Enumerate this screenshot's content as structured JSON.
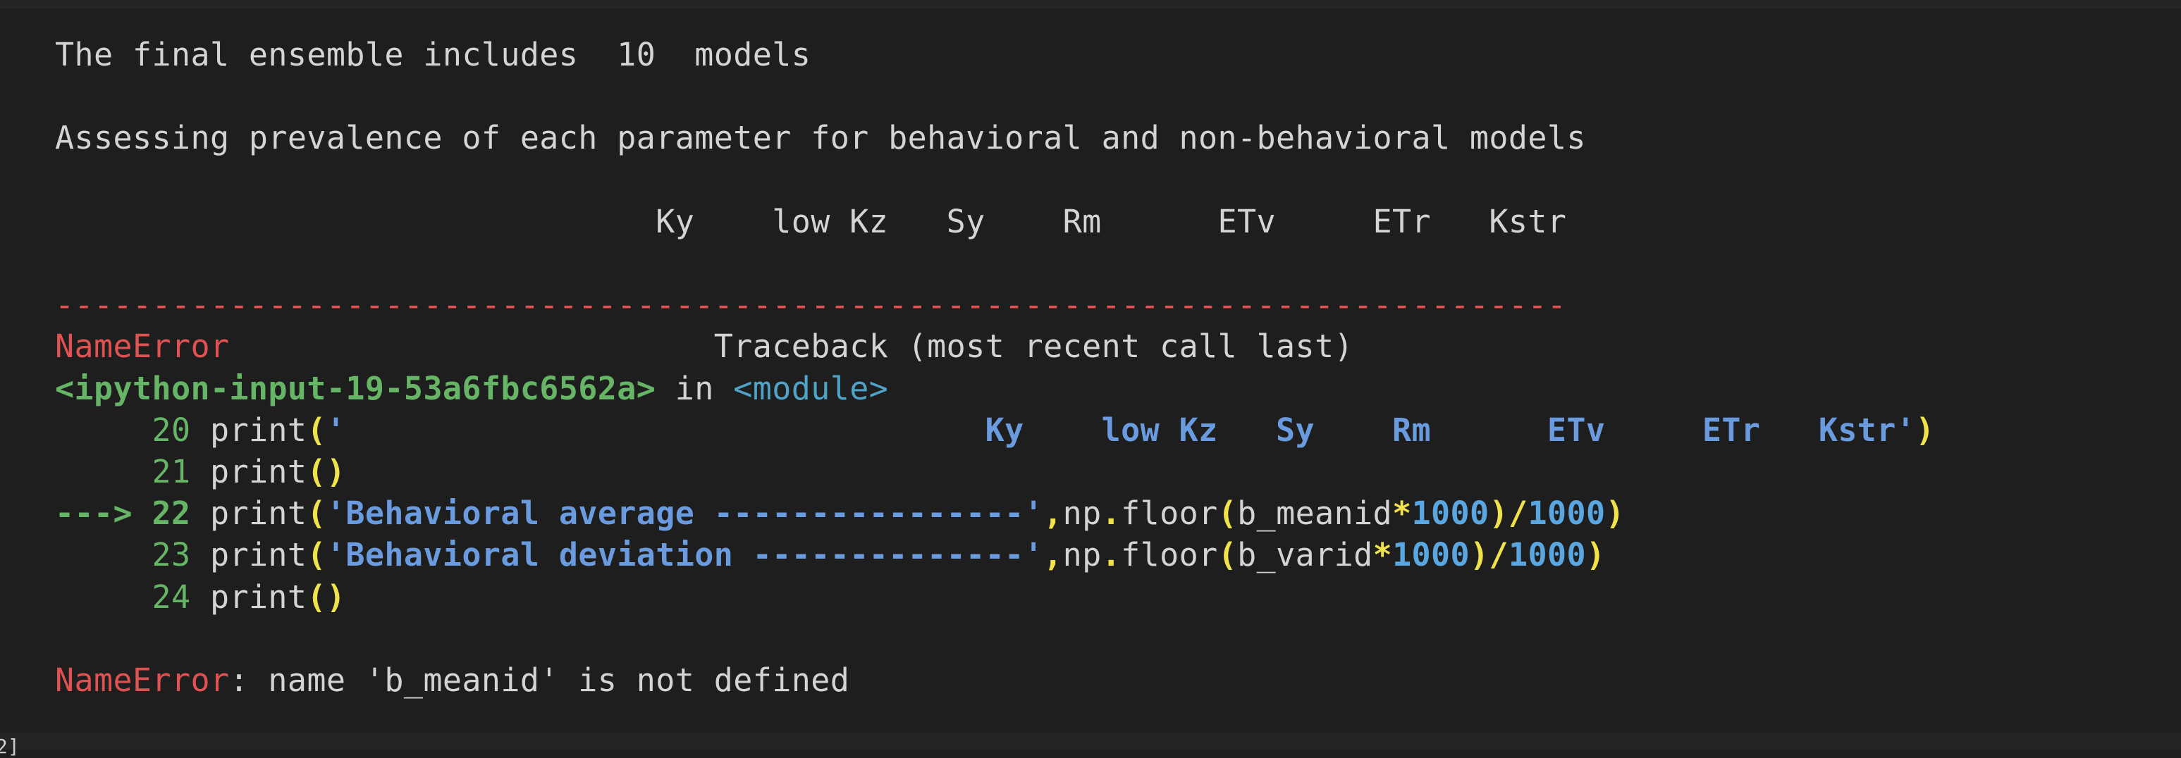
{
  "output": {
    "ensemble_line": "The final ensemble includes  10  models",
    "assessing_line": "Assessing prevalence of each parameter for behavioral and non-behavioral models",
    "header_line": "                               Ky    low Kz   Sy    Rm      ETv     ETr   Kstr"
  },
  "traceback": {
    "dashes": "------------------------------------------------------------------------------",
    "error_name": "NameError",
    "header_pad": "                         ",
    "header_text": "Traceback (most recent call last)",
    "input_ref": "<ipython-input-19-53a6fbc6562a>",
    "in_word": " in ",
    "module": "<module>",
    "lines": [
      {
        "prefix": "     20 ",
        "call": "print",
        "open": "(",
        "string": "'                                 Ky    low Kz   Sy    Rm      ETv     ETr   Kstr'",
        "close": ")"
      },
      {
        "prefix": "     21 ",
        "call": "print",
        "open": "(",
        "close": ")"
      },
      {
        "arrow": "---> 22 ",
        "call": "print",
        "open": "(",
        "string": "'Behavioral average ----------------'",
        "comma": ",",
        "np": "np",
        "dot": ".",
        "fn": "floor",
        "paren2": "(",
        "var": "b_meanid",
        "op": "*",
        "num1": "1000",
        "paren3": ")",
        "div": "/",
        "num2": "1000",
        "close": ")"
      },
      {
        "prefix": "     23 ",
        "call": "print",
        "open": "(",
        "string": "'Behavioral deviation --------------'",
        "comma": ",",
        "np": "np",
        "dot": ".",
        "fn": "floor",
        "paren2": "(",
        "var": "b_varid",
        "op": "*",
        "num1": "1000",
        "paren3": ")",
        "div": "/",
        "num2": "1000",
        "close": ")"
      },
      {
        "prefix": "     24 ",
        "call": "print",
        "open": "(",
        "close": ")"
      }
    ],
    "final_error_name": "NameError",
    "final_message": ": name 'b_meanid' is not defined"
  },
  "gutter": {
    "cell_number": "2]"
  }
}
